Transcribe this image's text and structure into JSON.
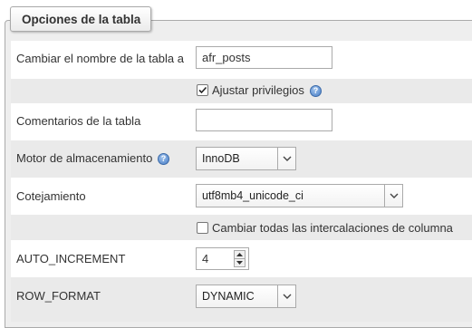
{
  "legend": "Opciones de la tabla",
  "rename": {
    "label": "Cambiar el nombre de la tabla a",
    "value": "afr_posts"
  },
  "adjust_privileges": {
    "label": "Ajustar privilegios",
    "checked": true
  },
  "comments": {
    "label": "Comentarios de la tabla",
    "value": ""
  },
  "engine": {
    "label": "Motor de almacenamiento",
    "selected": "InnoDB"
  },
  "collation": {
    "label": "Cotejamiento",
    "selected": "utf8mb4_unicode_ci"
  },
  "change_all_collations": {
    "label": "Cambiar todas las intercalaciones de columna",
    "checked": false
  },
  "auto_increment": {
    "label": "AUTO_INCREMENT",
    "value": "4"
  },
  "row_format": {
    "label": "ROW_FORMAT",
    "selected": "DYNAMIC"
  },
  "icons": {
    "help": "help-icon",
    "dropdown": "chevron-down-icon",
    "checkmark": "checkmark-icon"
  }
}
